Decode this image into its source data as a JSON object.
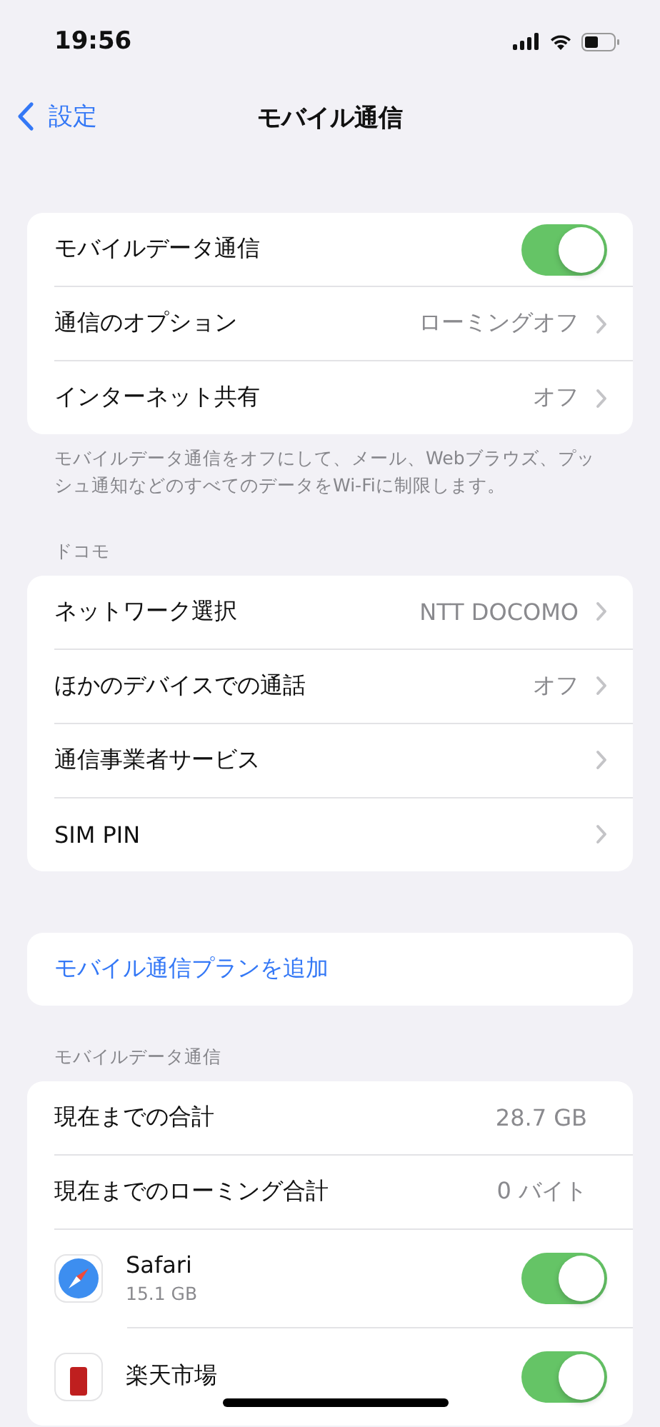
{
  "status_bar": {
    "time": "19:56"
  },
  "nav": {
    "back": "設定",
    "title": "モバイル通信"
  },
  "groups": [
    {
      "rows": [
        {
          "kind": "toggle",
          "label": "モバイルデータ通信",
          "on": true
        },
        {
          "kind": "link",
          "label": "通信のオプション",
          "value": "ローミングオフ"
        },
        {
          "kind": "link",
          "label": "インターネット共有",
          "value": "オフ"
        }
      ],
      "footer": "モバイルデータ通信をオフにして、メール、Webブラウズ、プッシュ通知などのすべてのデータをWi-Fiに制限します。"
    },
    {
      "header": "ドコモ",
      "rows": [
        {
          "kind": "link",
          "label": "ネットワーク選択",
          "value": "NTT DOCOMO"
        },
        {
          "kind": "link",
          "label": "ほかのデバイスでの通話",
          "value": "オフ"
        },
        {
          "kind": "link",
          "label": "通信事業者サービス"
        },
        {
          "kind": "link",
          "label": "SIM PIN"
        }
      ]
    },
    {
      "rows": [
        {
          "kind": "action",
          "label": "モバイル通信プランを追加"
        }
      ]
    },
    {
      "header": "モバイルデータ通信",
      "rows": [
        {
          "kind": "value",
          "label": "現在までの合計",
          "value": "28.7 GB"
        },
        {
          "kind": "value",
          "label": "現在までのローミング合計",
          "value": "0 バイト"
        },
        {
          "kind": "browser",
          "label": "Safari",
          "detail": "15.1 GB",
          "on": true
        },
        {
          "kind": "shop",
          "label": "楽天市場",
          "on": true
        }
      ]
    }
  ]
}
